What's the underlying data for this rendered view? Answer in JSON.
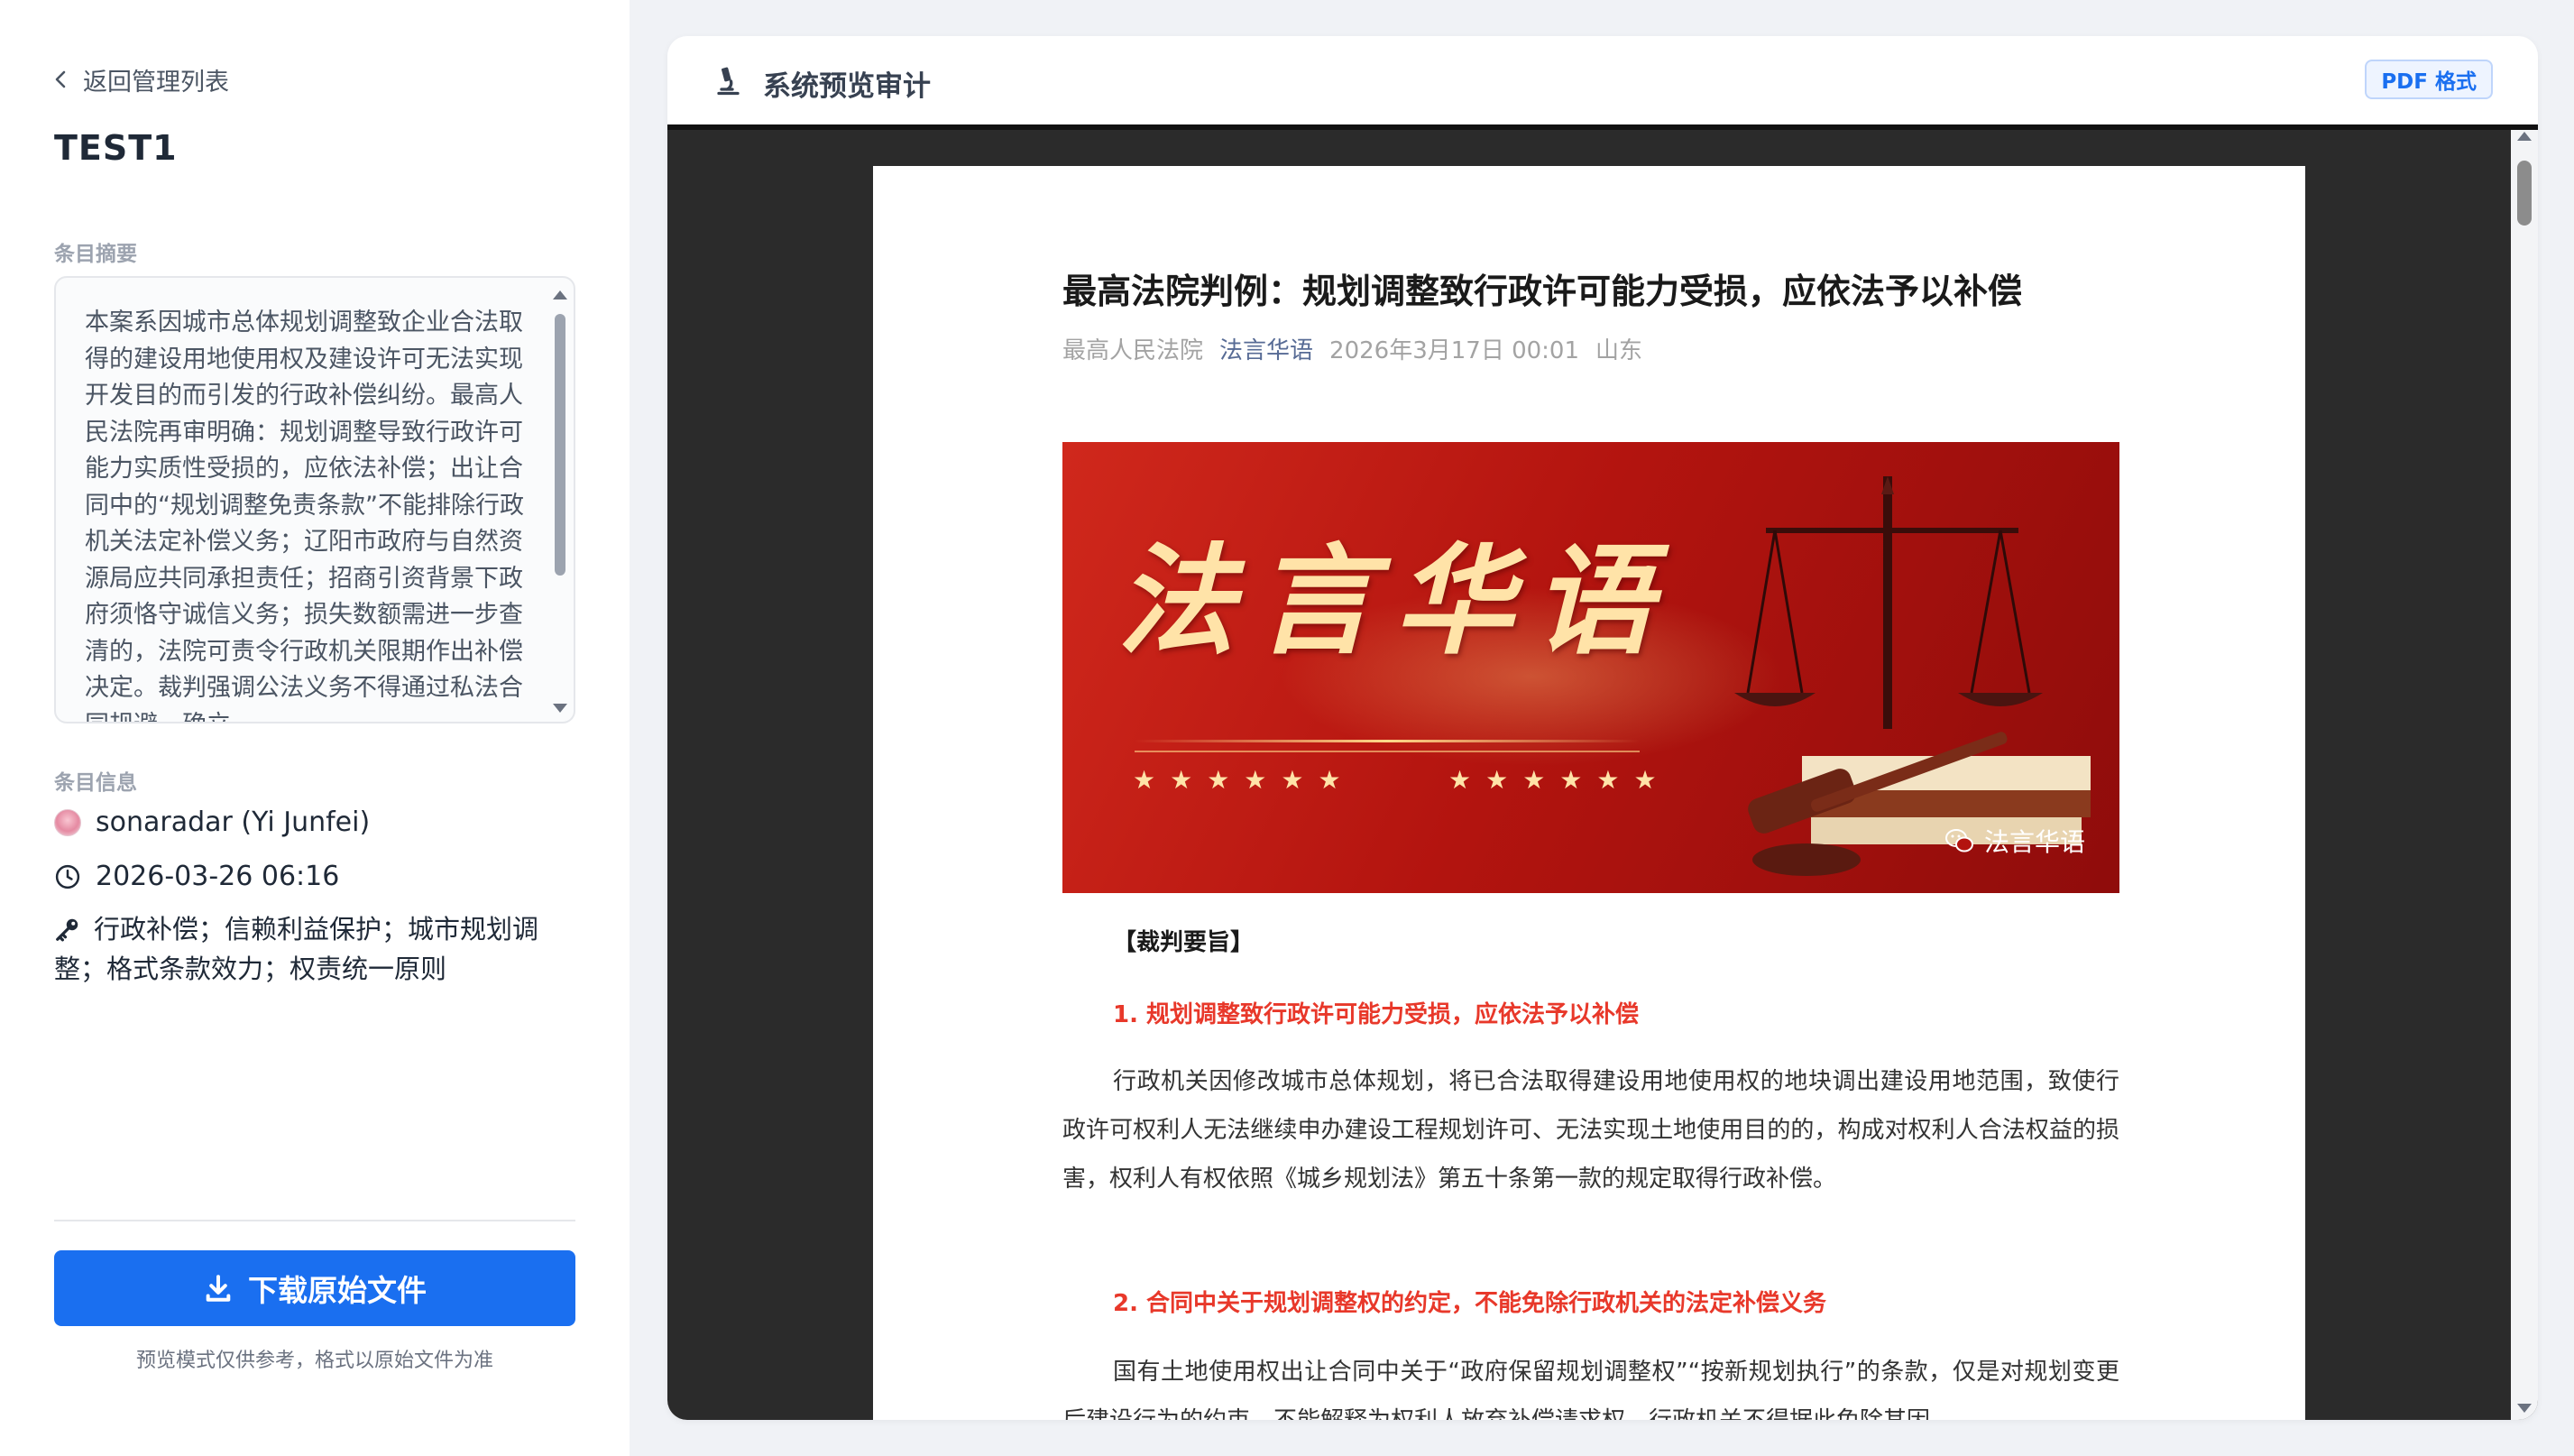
{
  "sidebar": {
    "back_label": "返回管理列表",
    "doc_title": "TEST1",
    "summary_label": "条目摘要",
    "summary_text": "本案系因城市总体规划调整致企业合法取得的建设用地使用权及建设许可无法实现开发目的而引发的行政补偿纠纷。最高人民法院再审明确：规划调整导致行政许可能力实质性受损的，应依法补偿；出让合同中的“规划调整免责条款”不能排除行政机关法定补偿义务；辽阳市政府与自然资源局应共同承担责任；招商引资背景下政府须恪守诚信义务；损失数额需进一步查清的，法院可责令行政机关限期作出补偿决定。裁判强调公法义务不得通过私法合同规避，确立",
    "info_label": "条目信息",
    "author": "sonaradar (Yi Junfei)",
    "datetime": "2026-03-26 06:16",
    "tags": "行政补偿；信赖利益保护；城市规划调整；格式条款效力；权责统一原则",
    "download_label": "下载原始文件",
    "footnote": "预览模式仅供参考，格式以原始文件为准"
  },
  "panel": {
    "title": "系统预览审计",
    "format_badge": "PDF 格式"
  },
  "article": {
    "title": "最高法院判例：规划调整致行政许可能力受损，应依法予以补偿",
    "meta": {
      "source": "最高人民法院",
      "account": "法言华语",
      "date": "2026年3月17日 00:01",
      "location": "山东"
    },
    "banner": {
      "calligraphy": "法言华语",
      "stars_left": "★★★★★★",
      "stars_right": "★★★★★★",
      "watermark": "法言华语"
    },
    "section_heading": "【裁判要旨】",
    "point1_title": "1. 规划调整致行政许可能力受损，应依法予以补偿",
    "point1_body": "行政机关因修改城市总体规划，将已合法取得建设用地使用权的地块调出建设用地范围，致使行政许可权利人无法继续申办建设工程规划许可、无法实现土地使用目的的，构成对权利人合法权益的损害，权利人有权依照《城乡规划法》第五十条第一款的规定取得行政补偿。",
    "point2_title": "2. 合同中关于规划调整权的约定，不能免除行政机关的法定补偿义务",
    "point2_body": "国有土地使用权出让合同中关于“政府保留规划调整权”“按新规划执行”的条款，仅是对规划变更后建设行为的约束，不能解释为权利人放弃补偿请求权。行政机关不得据此免除其因"
  },
  "colors": {
    "primary": "#1a6ff0",
    "accent_red": "#e8382a",
    "banner_red": "#b3140f",
    "link_blue": "#576b95"
  },
  "icons": {
    "back": "chevron-left-icon",
    "clock": "clock-icon",
    "key": "key-icon",
    "download": "download-icon",
    "microscope": "microscope-icon",
    "wechat": "wechat-icon"
  }
}
